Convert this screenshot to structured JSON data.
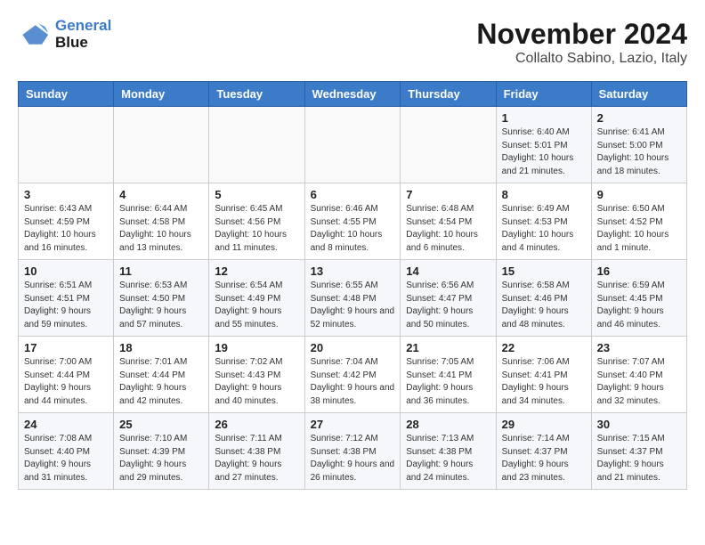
{
  "header": {
    "logo_line1": "General",
    "logo_line2": "Blue",
    "month_title": "November 2024",
    "subtitle": "Collalto Sabino, Lazio, Italy"
  },
  "weekdays": [
    "Sunday",
    "Monday",
    "Tuesday",
    "Wednesday",
    "Thursday",
    "Friday",
    "Saturday"
  ],
  "weeks": [
    [
      {
        "day": "",
        "info": ""
      },
      {
        "day": "",
        "info": ""
      },
      {
        "day": "",
        "info": ""
      },
      {
        "day": "",
        "info": ""
      },
      {
        "day": "",
        "info": ""
      },
      {
        "day": "1",
        "info": "Sunrise: 6:40 AM\nSunset: 5:01 PM\nDaylight: 10 hours and 21 minutes."
      },
      {
        "day": "2",
        "info": "Sunrise: 6:41 AM\nSunset: 5:00 PM\nDaylight: 10 hours and 18 minutes."
      }
    ],
    [
      {
        "day": "3",
        "info": "Sunrise: 6:43 AM\nSunset: 4:59 PM\nDaylight: 10 hours and 16 minutes."
      },
      {
        "day": "4",
        "info": "Sunrise: 6:44 AM\nSunset: 4:58 PM\nDaylight: 10 hours and 13 minutes."
      },
      {
        "day": "5",
        "info": "Sunrise: 6:45 AM\nSunset: 4:56 PM\nDaylight: 10 hours and 11 minutes."
      },
      {
        "day": "6",
        "info": "Sunrise: 6:46 AM\nSunset: 4:55 PM\nDaylight: 10 hours and 8 minutes."
      },
      {
        "day": "7",
        "info": "Sunrise: 6:48 AM\nSunset: 4:54 PM\nDaylight: 10 hours and 6 minutes."
      },
      {
        "day": "8",
        "info": "Sunrise: 6:49 AM\nSunset: 4:53 PM\nDaylight: 10 hours and 4 minutes."
      },
      {
        "day": "9",
        "info": "Sunrise: 6:50 AM\nSunset: 4:52 PM\nDaylight: 10 hours and 1 minute."
      }
    ],
    [
      {
        "day": "10",
        "info": "Sunrise: 6:51 AM\nSunset: 4:51 PM\nDaylight: 9 hours and 59 minutes."
      },
      {
        "day": "11",
        "info": "Sunrise: 6:53 AM\nSunset: 4:50 PM\nDaylight: 9 hours and 57 minutes."
      },
      {
        "day": "12",
        "info": "Sunrise: 6:54 AM\nSunset: 4:49 PM\nDaylight: 9 hours and 55 minutes."
      },
      {
        "day": "13",
        "info": "Sunrise: 6:55 AM\nSunset: 4:48 PM\nDaylight: 9 hours and 52 minutes."
      },
      {
        "day": "14",
        "info": "Sunrise: 6:56 AM\nSunset: 4:47 PM\nDaylight: 9 hours and 50 minutes."
      },
      {
        "day": "15",
        "info": "Sunrise: 6:58 AM\nSunset: 4:46 PM\nDaylight: 9 hours and 48 minutes."
      },
      {
        "day": "16",
        "info": "Sunrise: 6:59 AM\nSunset: 4:45 PM\nDaylight: 9 hours and 46 minutes."
      }
    ],
    [
      {
        "day": "17",
        "info": "Sunrise: 7:00 AM\nSunset: 4:44 PM\nDaylight: 9 hours and 44 minutes."
      },
      {
        "day": "18",
        "info": "Sunrise: 7:01 AM\nSunset: 4:44 PM\nDaylight: 9 hours and 42 minutes."
      },
      {
        "day": "19",
        "info": "Sunrise: 7:02 AM\nSunset: 4:43 PM\nDaylight: 9 hours and 40 minutes."
      },
      {
        "day": "20",
        "info": "Sunrise: 7:04 AM\nSunset: 4:42 PM\nDaylight: 9 hours and 38 minutes."
      },
      {
        "day": "21",
        "info": "Sunrise: 7:05 AM\nSunset: 4:41 PM\nDaylight: 9 hours and 36 minutes."
      },
      {
        "day": "22",
        "info": "Sunrise: 7:06 AM\nSunset: 4:41 PM\nDaylight: 9 hours and 34 minutes."
      },
      {
        "day": "23",
        "info": "Sunrise: 7:07 AM\nSunset: 4:40 PM\nDaylight: 9 hours and 32 minutes."
      }
    ],
    [
      {
        "day": "24",
        "info": "Sunrise: 7:08 AM\nSunset: 4:40 PM\nDaylight: 9 hours and 31 minutes."
      },
      {
        "day": "25",
        "info": "Sunrise: 7:10 AM\nSunset: 4:39 PM\nDaylight: 9 hours and 29 minutes."
      },
      {
        "day": "26",
        "info": "Sunrise: 7:11 AM\nSunset: 4:38 PM\nDaylight: 9 hours and 27 minutes."
      },
      {
        "day": "27",
        "info": "Sunrise: 7:12 AM\nSunset: 4:38 PM\nDaylight: 9 hours and 26 minutes."
      },
      {
        "day": "28",
        "info": "Sunrise: 7:13 AM\nSunset: 4:38 PM\nDaylight: 9 hours and 24 minutes."
      },
      {
        "day": "29",
        "info": "Sunrise: 7:14 AM\nSunset: 4:37 PM\nDaylight: 9 hours and 23 minutes."
      },
      {
        "day": "30",
        "info": "Sunrise: 7:15 AM\nSunset: 4:37 PM\nDaylight: 9 hours and 21 minutes."
      }
    ]
  ]
}
